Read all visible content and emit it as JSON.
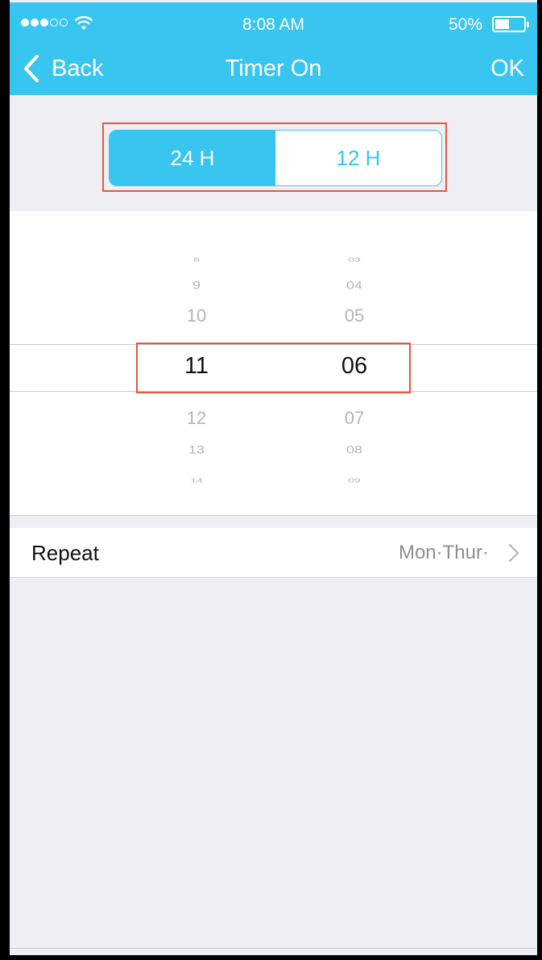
{
  "status_bar": {
    "time": "8:08 AM",
    "battery_percent": "50%",
    "battery_level": 0.5,
    "signal_bars_filled": 3,
    "signal_bars_total": 5
  },
  "nav": {
    "back_label": "Back",
    "title": "Timer On",
    "ok_label": "OK"
  },
  "format_toggle": {
    "options": [
      "24 H",
      "12 H"
    ],
    "selected": "24 H"
  },
  "time_picker": {
    "hours": [
      "8",
      "9",
      "10",
      "11",
      "12",
      "13",
      "14"
    ],
    "minutes": [
      "03",
      "04",
      "05",
      "06",
      "07",
      "08",
      "09"
    ],
    "selected_hour": "11",
    "selected_minute": "06"
  },
  "repeat": {
    "label": "Repeat",
    "value": "Mon·Thur·"
  },
  "colors": {
    "accent": "#38c5ef",
    "highlight": "#e8573f",
    "background": "#efeef3"
  }
}
